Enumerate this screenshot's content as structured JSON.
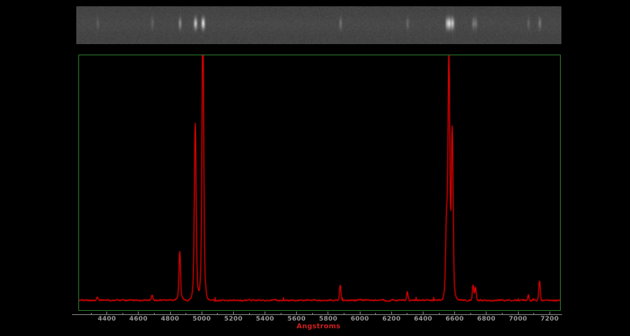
{
  "colors": {
    "background": "#000000",
    "frame_green": "#2d7e2f",
    "trace_red": "#ee0000",
    "axis_gray": "#8a8a8a",
    "tick_label_gray": "#969696",
    "xlabel_red": "#cf1f1f",
    "strip_gray": "#454545",
    "strip_line_bright": "#e8e8e8"
  },
  "chart_data": {
    "type": "line",
    "variant": "astronomical-emission-line-spectrum",
    "title": "",
    "xlabel": "Angstroms",
    "ylabel": "",
    "x_range": [
      4220,
      7270
    ],
    "x_ticks_major": [
      4400,
      4600,
      4800,
      5000,
      5200,
      5400,
      5600,
      5800,
      6000,
      6200,
      6400,
      6600,
      6800,
      7000,
      7200
    ],
    "x_minor_tick_step": 100,
    "y_axis_visible": false,
    "grid": false,
    "legend": "none",
    "continuum_level": 0.045,
    "series": [
      {
        "name": "extracted-1d-spectrum",
        "color": "#ee0000",
        "normalization": "strongest line = 1.0",
        "emission_lines": [
          {
            "wavelength": 4340,
            "rel_intensity": 0.015
          },
          {
            "wavelength": 4686,
            "rel_intensity": 0.025
          },
          {
            "wavelength": 4861,
            "rel_intensity": 0.182
          },
          {
            "wavelength": 4959,
            "rel_intensity": 0.655
          },
          {
            "wavelength": 5007,
            "rel_intensity": 1.0
          },
          {
            "wavelength": 5876,
            "rel_intensity": 0.067
          },
          {
            "wavelength": 6300,
            "rel_intensity": 0.036
          },
          {
            "wavelength": 6548,
            "rel_intensity": 0.261
          },
          {
            "wavelength": 6563,
            "rel_intensity": 0.873
          },
          {
            "wavelength": 6584,
            "rel_intensity": 0.615
          },
          {
            "wavelength": 6716,
            "rel_intensity": 0.067
          },
          {
            "wavelength": 6731,
            "rel_intensity": 0.058
          },
          {
            "wavelength": 7065,
            "rel_intensity": 0.022
          },
          {
            "wavelength": 7136,
            "rel_intensity": 0.085
          }
        ]
      }
    ],
    "strip": {
      "kind": "2d-spectrum-image",
      "appearance": "gray noisy band with vertical bright emission lines at same wavelengths as 1D spectrum"
    }
  }
}
